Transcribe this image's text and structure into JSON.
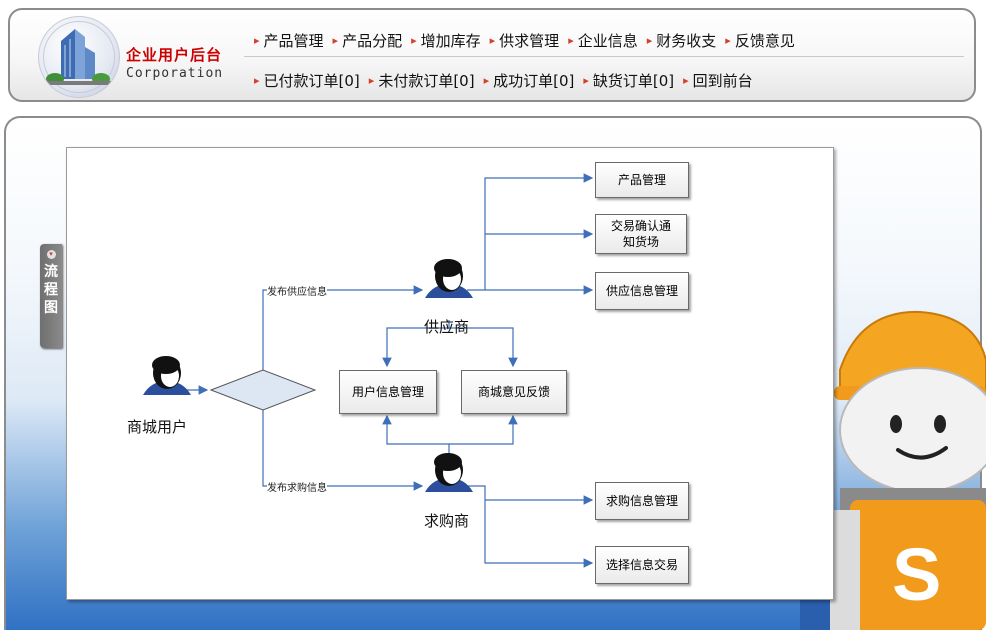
{
  "brand": {
    "name_cn": "企业用户后台",
    "name_en": "Corporation"
  },
  "nav": {
    "row1": [
      "产品管理",
      "产品分配",
      "增加库存",
      "供求管理",
      "企业信息",
      "财务收支",
      "反馈意见"
    ],
    "row2": [
      "已付款订单[0]",
      "未付款订单[0]",
      "成功订单[0]",
      "缺货订单[0]",
      "回到前台"
    ]
  },
  "side_tab": {
    "label": "流程图",
    "icon": "circle-arrow-icon"
  },
  "flowchart": {
    "people": {
      "mall_user": "商城用户",
      "supplier": "供应商",
      "buyer": "求购商"
    },
    "edges": {
      "publish_supply": "发布供应信息",
      "publish_demand": "发布求购信息"
    },
    "boxes": {
      "product_mgmt": "产品管理",
      "trade_confirm": "交易确认通知货场",
      "supply_info_mgmt": "供应信息管理",
      "user_info_mgmt": "用户信息管理",
      "mall_feedback": "商城意见反馈",
      "demand_info_mgmt": "求购信息管理",
      "select_trade": "选择信息交易"
    }
  },
  "mascot": {
    "letter": "S"
  },
  "colors": {
    "brand_red": "#cc0000",
    "nav_bullet": "#d4402a",
    "flow_line": "#3f6fb8",
    "diamond_fill": "#dde7f3",
    "panel_blue": "#2f71c4",
    "mascot_orange": "#f29a1c"
  }
}
